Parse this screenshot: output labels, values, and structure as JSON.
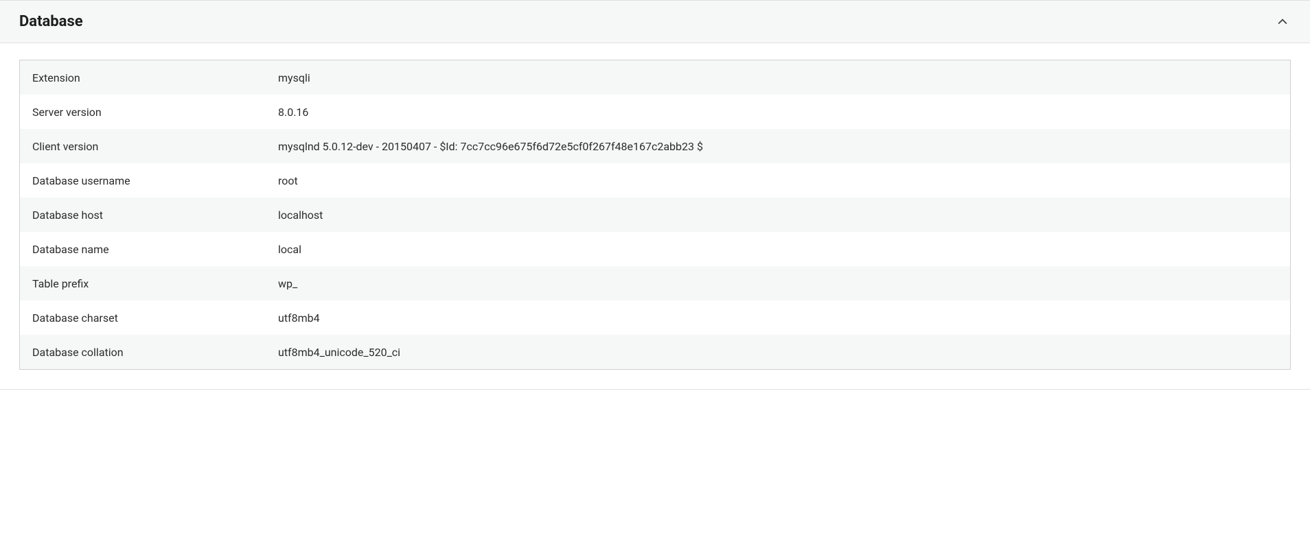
{
  "panel": {
    "title": "Database",
    "rows": [
      {
        "label": "Extension",
        "value": "mysqli"
      },
      {
        "label": "Server version",
        "value": "8.0.16"
      },
      {
        "label": "Client version",
        "value": "mysqlnd 5.0.12-dev - 20150407 - $Id: 7cc7cc96e675f6d72e5cf0f267f48e167c2abb23 $"
      },
      {
        "label": "Database username",
        "value": "root"
      },
      {
        "label": "Database host",
        "value": "localhost"
      },
      {
        "label": "Database name",
        "value": "local"
      },
      {
        "label": "Table prefix",
        "value": "wp_"
      },
      {
        "label": "Database charset",
        "value": "utf8mb4"
      },
      {
        "label": "Database collation",
        "value": "utf8mb4_unicode_520_ci"
      }
    ]
  }
}
